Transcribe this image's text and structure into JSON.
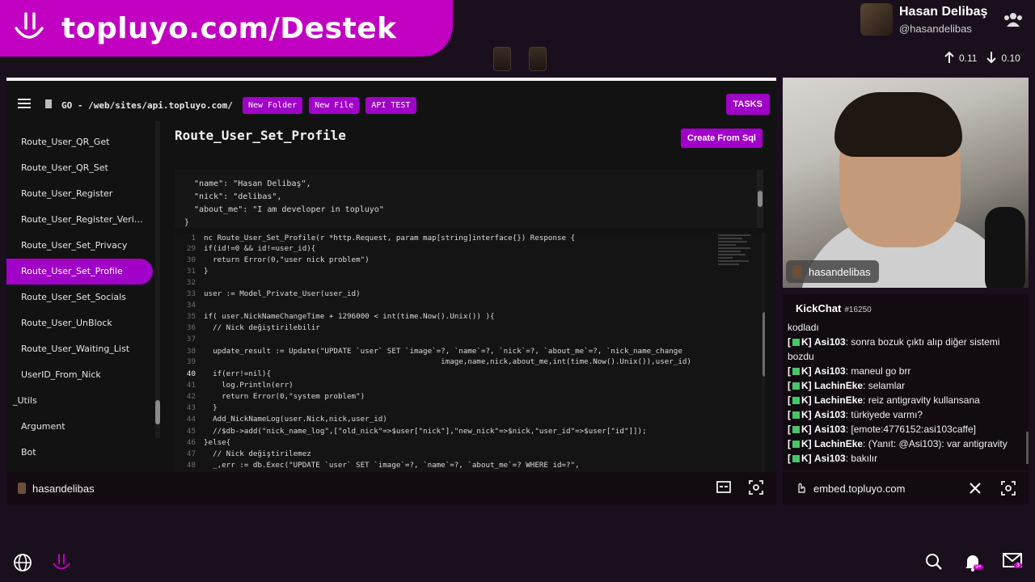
{
  "banner": {
    "title": "topluyo.com/Destek"
  },
  "profile": {
    "name": "Hasan Delibaş",
    "handle": "@hasandelibas"
  },
  "network": {
    "up": "0.11",
    "down": "0.10"
  },
  "editor": {
    "lang": "GO",
    "path": "- /web/sites/api.topluyo.com/",
    "buttons": [
      "New Folder",
      "New File",
      "API TEST"
    ],
    "tasks_label": "TASKS",
    "route_title": "Route_User_Set_Profile",
    "create_label": "Create From Sql",
    "sidebar": [
      {
        "label": "Route_User_QR_Get",
        "active": false
      },
      {
        "label": "Route_User_QR_Set",
        "active": false
      },
      {
        "label": "Route_User_Register",
        "active": false
      },
      {
        "label": "Route_User_Register_Veri…",
        "active": false
      },
      {
        "label": "Route_User_Set_Privacy",
        "active": false
      },
      {
        "label": "Route_User_Set_Profile",
        "active": true
      },
      {
        "label": "Route_User_Set_Socials",
        "active": false
      },
      {
        "label": "Route_User_UnBlock",
        "active": false
      },
      {
        "label": "Route_User_Waiting_List",
        "active": false
      },
      {
        "label": "UserID_From_Nick",
        "active": false
      },
      {
        "label": "_Utils",
        "active": false,
        "group": true
      },
      {
        "label": "Argument",
        "active": false
      },
      {
        "label": "Bot",
        "active": false
      }
    ],
    "json_lines": [
      "  \"name\": \"Hasan Delibaş\",",
      "  \"nick\": \"delibas\",",
      "  \"about_me\": \"I am developer in topluyo\"",
      "}"
    ],
    "code_lines": [
      {
        "n": "1",
        "t": "nc Route_User_Set_Profile(r *http.Request, param map[string]interface{}) Response {"
      },
      {
        "n": "29",
        "t": "if(id!=0 && id!=user_id){"
      },
      {
        "n": "30",
        "t": "  return Error(0,\"user nick problem\")"
      },
      {
        "n": "31",
        "t": "}"
      },
      {
        "n": "32",
        "t": ""
      },
      {
        "n": "33",
        "t": "user := Model_Private_User(user_id)"
      },
      {
        "n": "34",
        "t": ""
      },
      {
        "n": "35",
        "t": "if( user.NickNameChangeTime + 1296000 < int(time.Now().Unix()) ){"
      },
      {
        "n": "36",
        "t": "  // Nick değiştirilebilir"
      },
      {
        "n": "37",
        "t": ""
      },
      {
        "n": "38",
        "t": "  update_result := Update(\"UPDATE `user` SET `image`=?, `name`=?, `nick`=?, `about_me`=?, `nick_name_change"
      },
      {
        "n": "39",
        "t": "                                                     image,name,nick,about_me,int(time.Now().Unix()),user_id)"
      },
      {
        "n": "40",
        "t": "  if(err!=nil){",
        "cur": true
      },
      {
        "n": "41",
        "t": "    log.Println(err)"
      },
      {
        "n": "42",
        "t": "    return Error(0,\"system problem\")"
      },
      {
        "n": "43",
        "t": "  }"
      },
      {
        "n": "44",
        "t": "  Add_NickNameLog(user.Nick,nick,user_id)"
      },
      {
        "n": "45",
        "t": "  //$db->add(\"nick_name_log\",[\"old_nick\"=>$user[\"nick\"],\"new_nick\"=>$nick,\"user_id\"=>$user[\"id\"]]);"
      },
      {
        "n": "46",
        "t": "}else{"
      },
      {
        "n": "47",
        "t": "  // Nick değiştirilemez"
      },
      {
        "n": "48",
        "t": "  _,err := db.Exec(\"UPDATE `user` SET `image`=?, `name`=?, `about_me`=? WHERE id=?\","
      }
    ],
    "footer_label": "hasandelibas"
  },
  "webcam": {
    "tag": "hasandelibas"
  },
  "chat": {
    "title": "KickChat",
    "count": "#16250",
    "messages": [
      {
        "user": "",
        "text": "kodladı"
      },
      {
        "user": "Asi103",
        "text": "sonra bozuk çıktı alıp diğer sistemi bozdu"
      },
      {
        "user": "Asi103",
        "text": "maneul go brr"
      },
      {
        "user": "LachinEke",
        "text": "selamlar"
      },
      {
        "user": "LachinEke",
        "text": "reiz antigravity kullansana"
      },
      {
        "user": "Asi103",
        "text": "türkiyede varmı?"
      },
      {
        "user": "Asi103",
        "text": "[emote:4776152:asi103caffe]"
      },
      {
        "user": "LachinEke",
        "text": "(Yanıt: @Asi103): var antigravity"
      },
      {
        "user": "Asi103",
        "text": "bakılır"
      }
    ],
    "prefix": "[",
    "suffix": "K]"
  },
  "embed": {
    "label": "embed.topluyo.com"
  },
  "dock": {
    "notif_badge": "9+",
    "mail_badge": "3"
  },
  "colors": {
    "brand": "#c100c1",
    "accent": "#a000c8"
  }
}
